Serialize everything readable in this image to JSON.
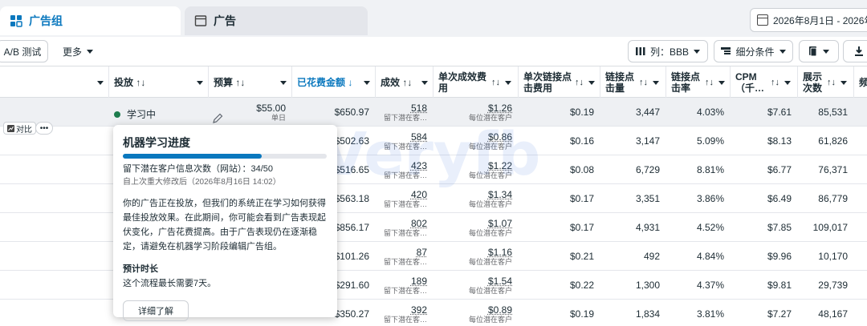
{
  "tabs": {
    "adsets": "广告组",
    "ads": "广告"
  },
  "date_range": "2026年8月1日 - 2026年",
  "toolbar": {
    "ab_test": "A/B 测试",
    "more": "更多",
    "columns": "列：BBB",
    "breakdown": "细分条件"
  },
  "headers": {
    "delivery": "投放 ↑↓",
    "budget": "预算 ↑↓",
    "spent": "已花费金额 ↓",
    "results": "成效 ↑↓",
    "cost_per_result": "单次成效费用",
    "cpc": "单次链接点击费用",
    "link_clicks": "链接点击量",
    "ctr": "链接点击率",
    "cpm": "CPM（千…",
    "impressions": "展示次数",
    "freq": "频"
  },
  "rows": [
    {
      "spent": "$650.97",
      "results": "518",
      "cpr": "$1.26",
      "cpc": "$0.19",
      "clicks": "3,447",
      "ctr": "4.03%",
      "cpm": "$7.61",
      "imp": "85,531",
      "budget": "$55.00"
    },
    {
      "spent": "$502.63",
      "results": "584",
      "cpr": "$0.86",
      "cpc": "$0.16",
      "clicks": "3,147",
      "ctr": "5.09%",
      "cpm": "$8.13",
      "imp": "61,826"
    },
    {
      "spent": "$516.65",
      "results": "423",
      "cpr": "$1.22",
      "cpc": "$0.08",
      "clicks": "6,729",
      "ctr": "8.81%",
      "cpm": "$6.77",
      "imp": "76,371"
    },
    {
      "spent": "$563.18",
      "results": "420",
      "cpr": "$1.34",
      "cpc": "$0.17",
      "clicks": "3,351",
      "ctr": "3.86%",
      "cpm": "$6.49",
      "imp": "86,779"
    },
    {
      "spent": "$856.17",
      "results": "802",
      "cpr": "$1.07",
      "cpc": "$0.17",
      "clicks": "4,931",
      "ctr": "4.52%",
      "cpm": "$7.85",
      "imp": "109,017"
    },
    {
      "spent": "$101.26",
      "results": "87",
      "cpr": "$1.16",
      "cpc": "$0.21",
      "clicks": "492",
      "ctr": "4.84%",
      "cpm": "$9.96",
      "imp": "10,170"
    },
    {
      "spent": "$291.60",
      "results": "189",
      "cpr": "$1.54",
      "cpc": "$0.22",
      "clicks": "1,300",
      "ctr": "4.37%",
      "cpm": "$9.81",
      "imp": "29,739"
    },
    {
      "spent": "$350.27",
      "results": "392",
      "cpr": "$0.89",
      "cpc": "$0.19",
      "clicks": "1,834",
      "ctr": "3.81%",
      "cpm": "$7.27",
      "imp": "48,167"
    }
  ],
  "result_sub": "留下潜在客…",
  "cpr_sub": "每位潜在客户",
  "budget_sub": "单日",
  "status_label": "学习中",
  "compare_label": "对比",
  "more_dots": "•••",
  "popover": {
    "title": "机器学习进度",
    "progress_fraction": 0.68,
    "progress_text": "留下潜在客户信息次数（网站）：34/50",
    "since": "自上次重大修改后（2026年8月16日 14:02）",
    "desc": "你的广告正在投放，但我们的系统正在学习如何获得最佳投放效果。在此期间，你可能会看到广告表现起伏变化，广告花费提高。由于广告表现仍在逐渐稳定，请避免在机器学习阶段编辑广告组。",
    "duration_title": "预计时长",
    "duration_text": "这个流程最长需要7天。",
    "learn_more": "详细了解"
  },
  "watermark": "Veryfb"
}
